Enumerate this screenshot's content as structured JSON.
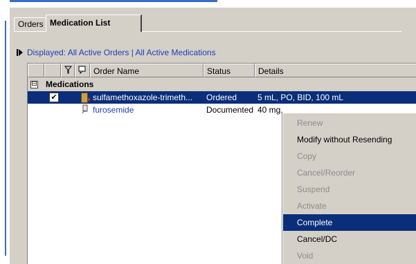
{
  "tabs": [
    {
      "label": "Orders",
      "active": false
    },
    {
      "label": "Medication List",
      "active": true
    }
  ],
  "displayed_text": "Displayed: All Active Orders | All Active Medications",
  "columns": {
    "order_name": "Order Name",
    "status": "Status",
    "details": "Details"
  },
  "group": {
    "toggle": "⊟",
    "label": "Medications"
  },
  "rows": [
    {
      "checked": true,
      "order_name": "sulfamethoxazole-trimeth...",
      "status": "Ordered",
      "details": "5 mL, PO, BID, 100 mL",
      "selected": true
    },
    {
      "checked": false,
      "order_name": "furosemide",
      "status": "Documented",
      "details": "40 mg,",
      "selected": false
    }
  ],
  "context_menu": [
    {
      "label": "Renew",
      "state": "disabled"
    },
    {
      "label": "Modify without Resending",
      "state": "enabled"
    },
    {
      "label": "Copy",
      "state": "disabled"
    },
    {
      "label": "Cancel/Reorder",
      "state": "disabled"
    },
    {
      "label": "Suspend",
      "state": "disabled"
    },
    {
      "label": "Activate",
      "state": "disabled"
    },
    {
      "label": "Complete",
      "state": "highlighted"
    },
    {
      "label": "Cancel/DC",
      "state": "enabled"
    },
    {
      "label": "Void",
      "state": "disabled"
    }
  ],
  "colors": {
    "selection": "#0a2e7a",
    "link": "#1f3fae",
    "panel": "#d4d0c8"
  }
}
